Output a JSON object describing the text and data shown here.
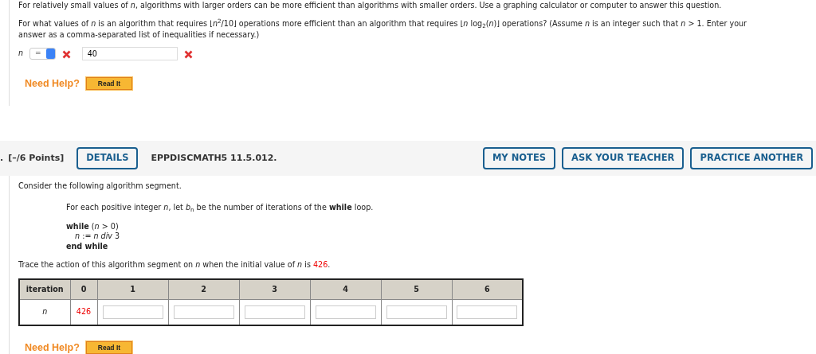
{
  "previous_question": {
    "intro": "For relatively small values of *n*, algorithms with larger orders can be more efficient than algorithms with smaller orders. Use a graphing calculator or computer to answer this question.",
    "question": "For what values of *n* is an algorithm that requires ⌊*n*$^{2}$/10⌋ operations more efficient than an algorithm that requires ⌊*n* log$_{2}$(*n*)⌋ operations? (Assume *n* is an integer such that *n* > 1. Enter your answer as a comma-separated list of inequalities if necessary.)",
    "answer": {
      "variable": "n",
      "operator": "=",
      "operator_correct": false,
      "value": "40",
      "value_correct": false
    },
    "help": {
      "label": "Need Help?",
      "button": "Read It"
    }
  },
  "question_header": {
    "number": ".",
    "points": "[–/6 Points]",
    "details": "DETAILS",
    "code": "EPPDISCMATH5 11.5.012.",
    "buttons": [
      "MY NOTES",
      "ASK YOUR TEACHER",
      "PRACTICE ANOTHER"
    ]
  },
  "question": {
    "intro": "Consider the following algorithm segment.",
    "statement": "For each positive integer *n*, let *b*$_{n}$ be the number of iterations of the **while** loop.",
    "code": [
      {
        "kind": "plain",
        "text": "**while** (*n* > 0)"
      },
      {
        "kind": "indented",
        "text": "*n* := *n div* 3"
      },
      {
        "kind": "bold",
        "text": "end while"
      }
    ],
    "trace": {
      "before": "Trace the action of this algorithm segment on *n* when the initial value of *n* is",
      "value": "426",
      "after": "."
    },
    "table": {
      "header_label": "iteration",
      "columns": [
        "0",
        "1",
        "2",
        "3",
        "4",
        "5",
        "6"
      ],
      "row_label": "n",
      "cells": [
        {
          "kind": "given",
          "value": "426"
        },
        {
          "kind": "input"
        },
        {
          "kind": "input"
        },
        {
          "kind": "input"
        },
        {
          "kind": "input"
        },
        {
          "kind": "input"
        },
        {
          "kind": "input"
        }
      ]
    },
    "help": {
      "label": "Need Help?",
      "button": "Read It"
    }
  }
}
